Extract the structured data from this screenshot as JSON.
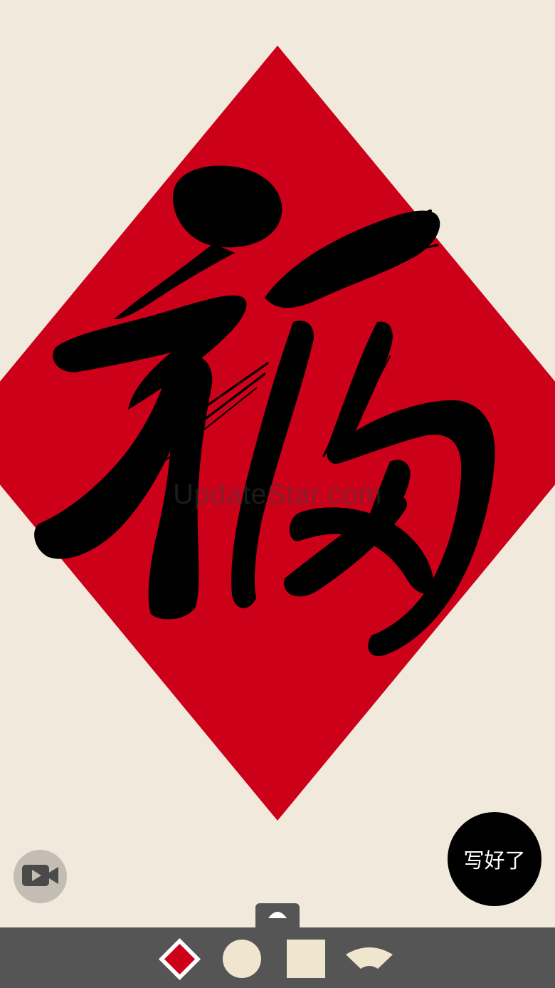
{
  "watermark": "UpdateStar.com",
  "actions": {
    "done_label": "写好了"
  },
  "colors": {
    "background": "#f1e9dc",
    "paper_red": "#cc0019",
    "ink": "#000000",
    "toolbar": "#555555",
    "cream": "#f0e6cf"
  },
  "icons": {
    "record": "video-camera-icon",
    "drawer": "chevron-up-icon"
  },
  "paper_shapes": [
    "diamond-red",
    "circle",
    "square",
    "fan"
  ]
}
